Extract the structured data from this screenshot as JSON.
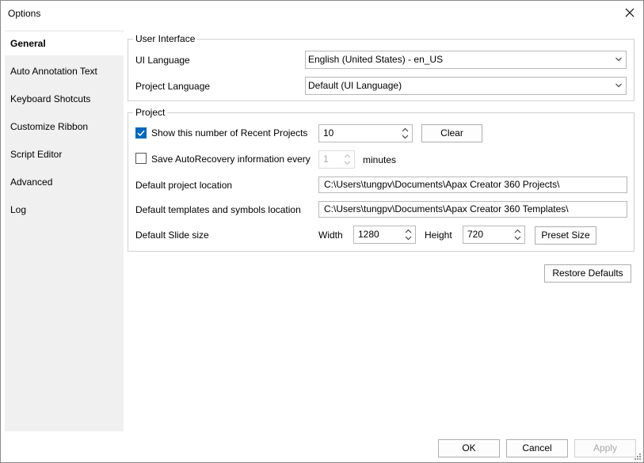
{
  "window": {
    "title": "Options"
  },
  "sidebar": {
    "items": [
      {
        "label": "General",
        "active": true
      },
      {
        "label": "Auto Annotation Text"
      },
      {
        "label": "Keyboard Shotcuts"
      },
      {
        "label": "Customize Ribbon"
      },
      {
        "label": "Script Editor"
      },
      {
        "label": "Advanced"
      },
      {
        "label": "Log"
      }
    ]
  },
  "ui_interface": {
    "group_label": "User Interface",
    "ui_language_label": "UI Language",
    "ui_language_value": "English (United States) - en_US",
    "project_language_label": "Project Language",
    "project_language_value": "Default (UI Language)"
  },
  "project": {
    "group_label": "Project",
    "recent_projects_label": "Show this number of Recent Projects",
    "recent_projects_checked": true,
    "recent_projects_value": "10",
    "clear_label": "Clear",
    "autorecovery_label": "Save AutoRecovery information every",
    "autorecovery_checked": false,
    "autorecovery_value": "1",
    "minutes_label": "minutes",
    "default_location_label": "Default project location",
    "default_location_value": "C:\\Users\\tungpv\\Documents\\Apax Creator 360 Projects\\",
    "templates_location_label": "Default templates and symbols location",
    "templates_location_value": "C:\\Users\\tungpv\\Documents\\Apax Creator 360 Templates\\",
    "slide_size_label": "Default Slide size",
    "width_label": "Width",
    "width_value": "1280",
    "height_label": "Height",
    "height_value": "720",
    "preset_size_label": "Preset Size"
  },
  "restore_defaults_label": "Restore Defaults",
  "footer": {
    "ok_label": "OK",
    "cancel_label": "Cancel",
    "apply_label": "Apply"
  },
  "colors": {
    "accent": "#0067c0",
    "sidebar_bg": "#f0f0f0",
    "border": "#d0d0d0"
  }
}
